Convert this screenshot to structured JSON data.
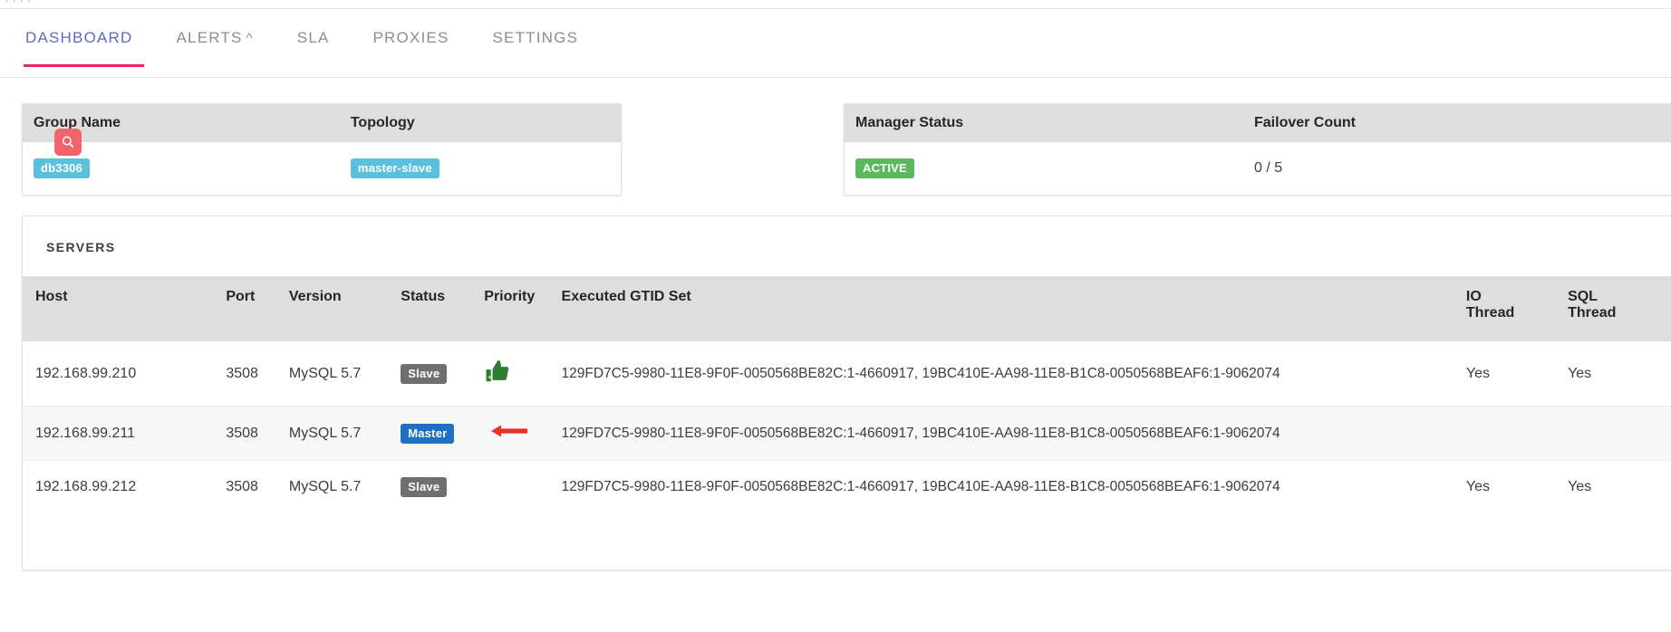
{
  "window": {
    "clipped_top_text": "  .      .   .  ."
  },
  "tabs": [
    {
      "label": "DASHBOARD",
      "active": true,
      "caret": ""
    },
    {
      "label": "ALERTS",
      "active": false,
      "caret": "^"
    },
    {
      "label": "SLA",
      "active": false,
      "caret": ""
    },
    {
      "label": "PROXIES",
      "active": false,
      "caret": ""
    },
    {
      "label": "SETTINGS",
      "active": false,
      "caret": ""
    }
  ],
  "group_card": {
    "headers": {
      "group_name": "Group Name",
      "topology": "Topology"
    },
    "search_icon": "search-icon",
    "group_name_value": "db3306",
    "topology_value": "master-slave"
  },
  "manager_card": {
    "headers": {
      "manager_status": "Manager Status",
      "failover_count": "Failover Count"
    },
    "manager_status_value": "ACTIVE",
    "failover_count_value": "0 / 5"
  },
  "servers": {
    "section_title": "SERVERS",
    "columns": {
      "host": "Host",
      "port": "Port",
      "version": "Version",
      "status": "Status",
      "priority": "Priority",
      "gtid": "Executed GTID Set",
      "io_thread_line1": "IO",
      "io_thread_line2": "Thread",
      "sql_thread_line1": "SQL",
      "sql_thread_line2": "Thread"
    },
    "rows": [
      {
        "host": "192.168.99.210",
        "port": "3508",
        "version": "MySQL 5.7",
        "status": "Slave",
        "status_kind": "slave",
        "priority_icon": "thumbs-up-icon",
        "gtid": "129FD7C5-9980-11E8-9F0F-0050568BE82C:1-4660917, 19BC410E-AA98-11E8-B1C8-0050568BEAF6:1-9062074",
        "io_thread": "Yes",
        "sql_thread": "Yes"
      },
      {
        "host": "192.168.99.211",
        "port": "3508",
        "version": "MySQL 5.7",
        "status": "Master",
        "status_kind": "master",
        "priority_icon": "left-arrow-icon",
        "gtid": "129FD7C5-9980-11E8-9F0F-0050568BE82C:1-4660917, 19BC410E-AA98-11E8-B1C8-0050568BEAF6:1-9062074",
        "io_thread": "",
        "sql_thread": ""
      },
      {
        "host": "192.168.99.212",
        "port": "3508",
        "version": "MySQL 5.7",
        "status": "Slave",
        "status_kind": "slave",
        "priority_icon": "",
        "gtid": "129FD7C5-9980-11E8-9F0F-0050568BE82C:1-4660917, 19BC410E-AA98-11E8-B1C8-0050568BEAF6:1-9062074",
        "io_thread": "Yes",
        "sql_thread": "Yes"
      }
    ]
  },
  "colors": {
    "accent_underline": "#e8275a",
    "active_tab_text": "#5c6bc0",
    "badge_info": "#5bc0de",
    "badge_success": "#5cb85c",
    "badge_master": "#1f6fc4",
    "badge_slave": "#6f6f6f",
    "search_badge": "#f1646b",
    "thumb_green": "#2e7d32",
    "arrow_red": "#e8312a",
    "table_header_bg": "#dedede"
  }
}
